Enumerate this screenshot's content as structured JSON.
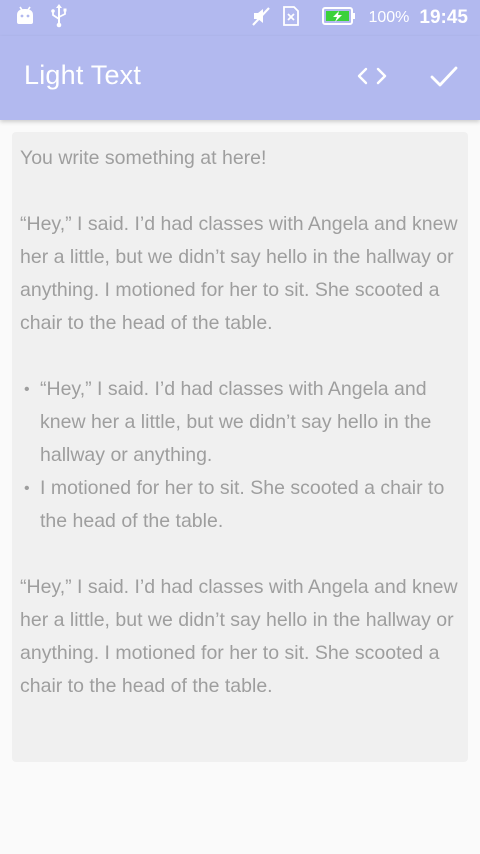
{
  "status_bar": {
    "battery_percent": "100%",
    "time": "19:45",
    "icons": [
      "android-debug-icon",
      "usb-icon",
      "mute-icon",
      "no-sim-icon",
      "battery-charging-icon"
    ]
  },
  "app_bar": {
    "title": "Light Text",
    "actions": [
      {
        "name": "code-view-icon"
      },
      {
        "name": "check-icon"
      }
    ]
  },
  "editor": {
    "first_line": "You write something at here!",
    "paragraph_1": "“Hey,” I said. I’d had classes with Angela and knew her a little, but we didn’t say hello in the hallway or anything. I motioned for her to sit. She scooted a chair to the head of the table.",
    "bullets": [
      "“Hey,” I said. I’d had classes with Angela and knew her a little, but we didn’t say hello in the hallway or anything.",
      "I motioned for her to sit. She scooted a chair to the head of the table."
    ],
    "bullet_glyph": "•",
    "paragraph_2": "“Hey,” I said. I’d had classes with Angela and knew her a little, but we didn’t say hello in the hallway or anything. I motioned for her to sit. She scooted a chair to the head of the table."
  },
  "colors": {
    "app_bar": "#b2b9ef",
    "editor_bg": "#f0f0f0",
    "text": "#9e9e9e",
    "page_bg": "#fafafa"
  }
}
